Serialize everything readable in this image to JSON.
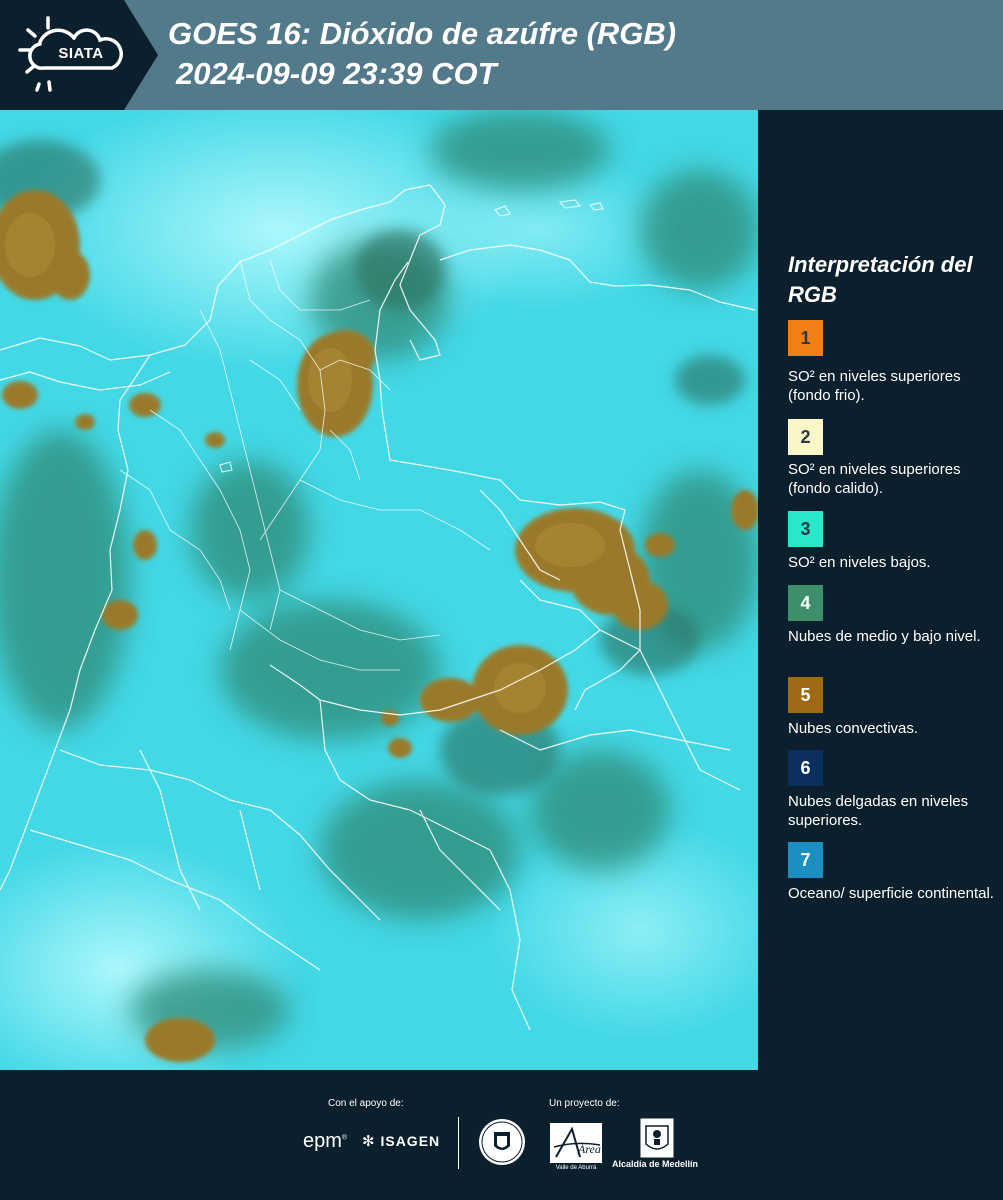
{
  "header": {
    "logo_text": "SIATA",
    "title_line1": "GOES 16: Dióxido de azúfre (RGB)",
    "title_line2": "2024-09-09 23:39 COT"
  },
  "legend": {
    "title": "Interpretación del RGB",
    "items": [
      {
        "number": "1",
        "color": "#f07f14",
        "text": "SO² en niveles superiores (fondo frio)."
      },
      {
        "number": "2",
        "color": "#fbf6c8",
        "text": "SO² en niveles superiores (fondo calido)."
      },
      {
        "number": "3",
        "color": "#29e8c9",
        "text": "SO² en niveles bajos."
      },
      {
        "number": "4",
        "color": "#3d8f6a",
        "text": "Nubes de medio y bajo nivel."
      },
      {
        "number": "5",
        "color": "#a06a14",
        "text": "Nubes convectivas."
      },
      {
        "number": "6",
        "color": "#0c305e",
        "text": "Nubes delgadas en niveles superiores."
      },
      {
        "number": "7",
        "color": "#1a8fc0",
        "text": "Oceano/ superficie continental."
      }
    ]
  },
  "footer": {
    "support_label": "Con el apoyo de:",
    "project_label": "Un proyecto de:",
    "epm_text": "epm",
    "isagen_text": "ISAGEN",
    "area_text": "Área",
    "area_subtext": "METROPOLITANA Valle de Aburrá",
    "alcaldia_text": "Alcaldía de Medellín"
  },
  "icons": {
    "sun_cloud": "sun-cloud-icon",
    "isagen_mark": "isagen-flower-icon",
    "seal": "municipal-seal-icon",
    "coat_of_arms": "coat-of-arms-icon"
  }
}
